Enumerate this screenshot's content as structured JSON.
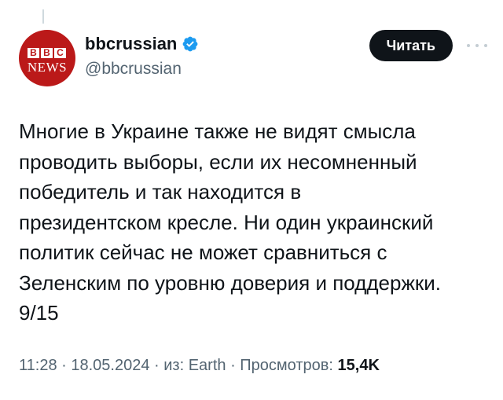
{
  "author": {
    "avatar_blocks": [
      "B",
      "B",
      "C"
    ],
    "avatar_subtitle": "NEWS",
    "display_name": "bbcrussian",
    "handle": "@bbcrussian",
    "verified": true,
    "verified_color": "#1d9bf0",
    "avatar_color": "#bb1919"
  },
  "actions": {
    "read_label": "Читать",
    "more_icon": "more-horizontal-icon"
  },
  "tweet": {
    "text": "Многие в Украине также не видят смысла\nпроводить выборы, если их несомненный\nпобедитель и так находится в\nпрезидентском кресле. Ни один украинский\nполитик сейчас не может сравниться с\nЗеленским по уровню доверия и поддержки.\n9/15"
  },
  "meta": {
    "time": "11:28",
    "separator": " · ",
    "date": "18.05.2024",
    "source": "из: Earth",
    "views_label": "Просмотров:",
    "views_count": "15,4K"
  }
}
